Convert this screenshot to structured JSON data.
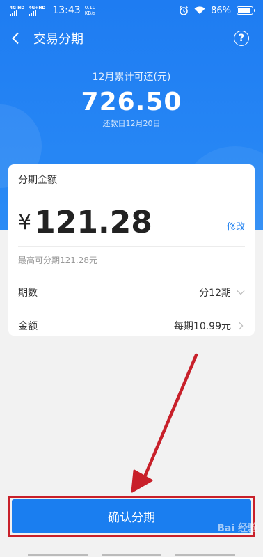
{
  "status_bar": {
    "net1": "4G HD",
    "net2": "4G+HD",
    "time": "13:43",
    "speed_value": "0.10",
    "speed_unit": "KB/s",
    "battery": "86%"
  },
  "nav": {
    "title": "交易分期"
  },
  "summary": {
    "label": "12月累计可还(元)",
    "amount": "726.50",
    "due_date": "还款日12月20日"
  },
  "card": {
    "title": "分期金额",
    "currency": "¥",
    "amount": "121.28",
    "edit_label": "修改",
    "hint": "最高可分期121.28元",
    "periods_label": "期数",
    "periods_value": "分12期",
    "amount_label": "金额",
    "amount_value": "每期10.99元"
  },
  "confirm_button": {
    "label": "确认分期"
  },
  "watermark": "Bai 经验",
  "colors": {
    "brand_blue": "#1a7ef0",
    "annotation_red": "#c8202a"
  },
  "icons": [
    "back-arrow-icon",
    "help-icon",
    "chevron-down-icon",
    "chevron-right-icon",
    "alarm-icon",
    "wifi-icon",
    "battery-icon"
  ]
}
